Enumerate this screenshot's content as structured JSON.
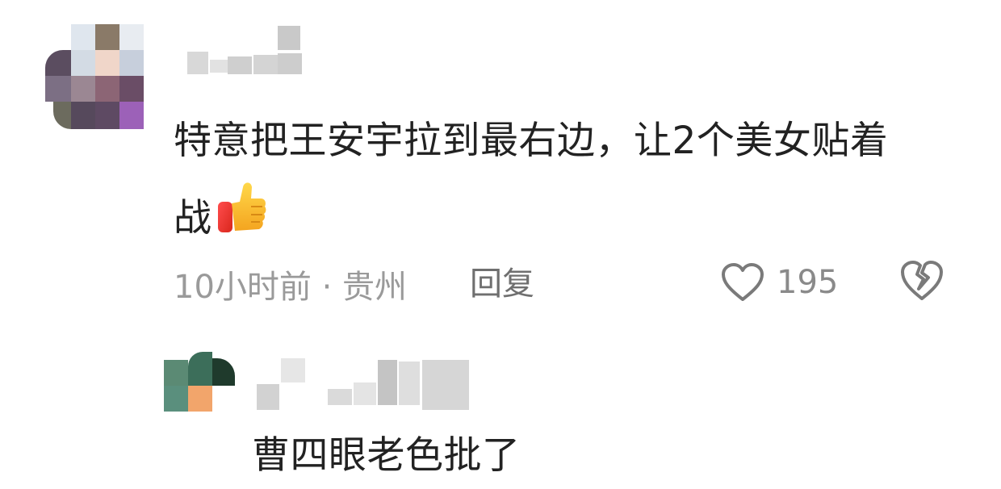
{
  "comment": {
    "text_line1": "特意把王安宇拉到最右边，让2个美女贴着",
    "text_line2": "战",
    "emoji": "thumbs-up-icon",
    "time_location": "10小时前 · 贵州",
    "reply_label": "回复",
    "like_count": "195"
  },
  "reply": {
    "text": "曹四眼老色批了"
  },
  "colors": {
    "text": "#222222",
    "meta": "#9a9a9a",
    "icon": "#7a7a7a"
  }
}
